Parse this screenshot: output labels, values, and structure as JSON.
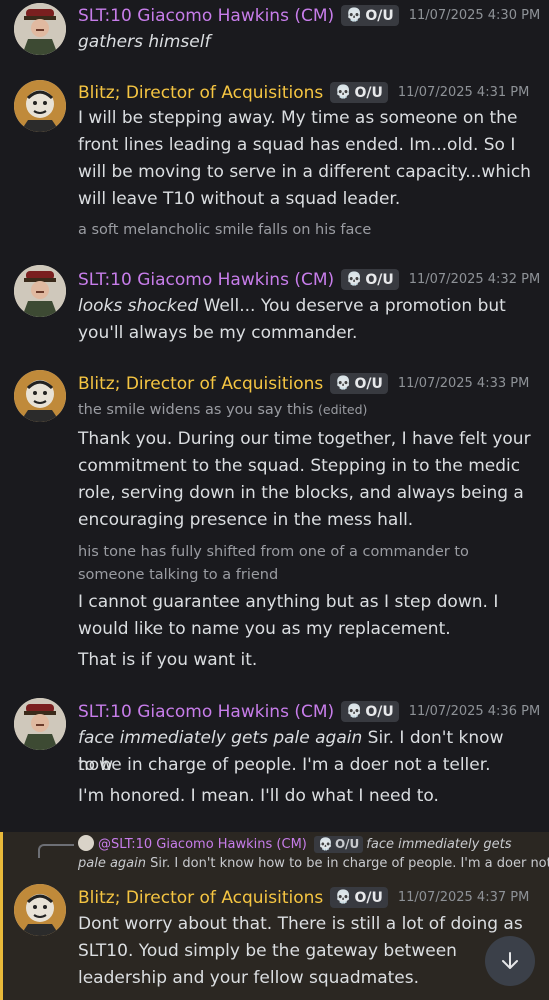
{
  "messages": [
    {
      "author": "SLT:10 Giacomo Hawkins (CM)",
      "tag": "O/U",
      "timestamp": "11/07/2025 4:30 PM",
      "lines": [
        {
          "italic": "gathers himself",
          "text": ""
        }
      ]
    },
    {
      "author": "Blitz; Director of Acquisitions",
      "tag": "O/U",
      "timestamp": "11/07/2025 4:31 PM",
      "lines": [
        {
          "text": "I will be stepping away. My time as someone on the"
        },
        {
          "text": "front lines leading a squad has ended. Im...old. So I"
        },
        {
          "text": "will be moving to serve in a different capacity...which"
        },
        {
          "text": "will leave T10 without a squad leader."
        },
        {
          "text": "a soft melancholic smile falls on his face"
        }
      ]
    },
    {
      "author": "SLT:10 Giacomo Hawkins (CM)",
      "tag": "O/U",
      "timestamp": "11/07/2025 4:32 PM",
      "lines": [
        {
          "italic": "looks shocked",
          "text": " Well... You deserve a promotion but"
        },
        {
          "text": "you'll always be my commander."
        }
      ]
    },
    {
      "author": "Blitz; Director of Acquisitions",
      "tag": "O/U",
      "timestamp": "11/07/2025 4:33 PM",
      "lines": [
        {
          "text": "the smile widens as you say this",
          "edited": "(edited)"
        },
        {
          "text": "Thank you. During our time together, I have felt your"
        },
        {
          "text": "commitment to the squad. Stepping in to the medic"
        },
        {
          "text": "role, serving down in the blocks, and always being a"
        },
        {
          "text": "encouraging presence in the mess hall."
        },
        {
          "text": "his tone has fully shifted from one of a commander to"
        },
        {
          "text": "someone talking to a friend"
        },
        {
          "text": "I cannot guarantee anything but as I step down. I"
        },
        {
          "text": "would like to name you as my replacement."
        },
        {
          "text": "That is if you want it."
        }
      ]
    },
    {
      "author": "SLT:10 Giacomo Hawkins (CM)",
      "tag": "O/U",
      "timestamp": "11/07/2025 4:36 PM",
      "lines": [
        {
          "italic": "face immediately gets pale again",
          "text": " Sir. I don't know how"
        },
        {
          "text": "to be in charge of people. I'm a doer not a teller."
        },
        {
          "text": "I'm honored. I mean. I'll do what I need to."
        }
      ]
    },
    {
      "author": "Blitz; Director of Acquisitions",
      "tag": "O/U",
      "timestamp": "11/07/2025 4:37 PM",
      "reply": {
        "author": "@SLT:10 Giacomo Hawkins (CM)",
        "tag": "O/U",
        "italic": "face immediately gets",
        "line2_italic": "pale again",
        "line2_text": " Sir. I don't know how to be in charge of people. I'm a doer not"
      },
      "lines": [
        {
          "text": "Dont worry about that. There is still a lot of doing as"
        },
        {
          "text": "SLT10. Youd simply be the gateway between"
        },
        {
          "text": "leadership and your fellow squadmates."
        }
      ]
    }
  ],
  "colors": {
    "background": "#1a1a1e",
    "slt_name": "#c77dea",
    "blitz_name": "#f5c542",
    "reply_highlight_bar": "#e8b93a"
  },
  "icons": {
    "tag_icon": "skull-icon",
    "scroll": "arrow-down-icon"
  }
}
